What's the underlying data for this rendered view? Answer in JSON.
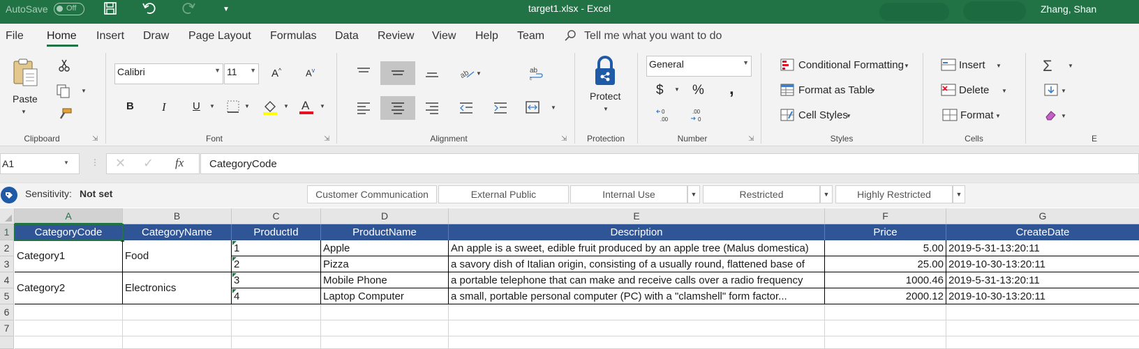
{
  "titlebar": {
    "autosave_label": "AutoSave",
    "autosave_state": "Off",
    "doc_title": "target1.xlsx  -  Excel",
    "user_name": "Zhang, Shan",
    "icons": [
      "save-icon",
      "undo-icon",
      "redo-icon",
      "customize-qat-icon"
    ],
    "accent": "#217346"
  },
  "tabs": [
    "File",
    "Home",
    "Insert",
    "Draw",
    "Page Layout",
    "Formulas",
    "Data",
    "Review",
    "View",
    "Help",
    "Team"
  ],
  "active_tab": "Home",
  "tell_me": "Tell me what you want to do",
  "ribbon": {
    "clipboard": {
      "paste": "Paste",
      "label": "Clipboard"
    },
    "font": {
      "name": "Calibri",
      "size": "11",
      "bold": "B",
      "italic": "I",
      "underline": "U",
      "label": "Font"
    },
    "alignment": {
      "label": "Alignment"
    },
    "protection": {
      "protect": "Protect",
      "label": "Protection"
    },
    "number": {
      "format": "General",
      "currency": "$",
      "percent": "%",
      "comma": ",",
      "increase_decimal": ".00",
      "label": "Number"
    },
    "styles": {
      "conditional": "Conditional Formatting",
      "format_table": "Format as Table",
      "cell_styles": "Cell Styles",
      "label": "Styles"
    },
    "cells": {
      "insert": "Insert",
      "delete": "Delete",
      "format": "Format",
      "label": "Cells"
    },
    "editing": {
      "label": "E"
    }
  },
  "formula_bar": {
    "name_box": "A1",
    "formula": "CategoryCode"
  },
  "sensitivity": {
    "label": "Sensitivity:",
    "value": "Not set",
    "options": [
      "Customer Communication",
      "External Public",
      "Internal Use",
      "Restricted",
      "Highly Restricted"
    ]
  },
  "grid": {
    "columns": [
      "A",
      "B",
      "C",
      "D",
      "E",
      "F",
      "G"
    ],
    "rows": [
      "1",
      "2",
      "3",
      "4",
      "5",
      "6",
      "7"
    ],
    "header_color": "#2f5597",
    "headers": [
      "CategoryCode",
      "CategoryName",
      "ProductId",
      "ProductName",
      "Description",
      "Price",
      "CreateDate"
    ],
    "categories": [
      {
        "code": "Category1",
        "name": "Food"
      },
      {
        "code": "Category2",
        "name": "Electronics"
      }
    ],
    "products": [
      {
        "id": "1",
        "name": "Apple",
        "description": "An apple is a sweet, edible fruit produced by an apple tree (Malus domestica)",
        "price": "5.00",
        "date": "2019-5-31-13:20:11"
      },
      {
        "id": "2",
        "name": "Pizza",
        "description": "a savory dish of Italian origin, consisting of a usually round, flattened base of",
        "price": "25.00",
        "date": "2019-10-30-13:20:11"
      },
      {
        "id": "3",
        "name": "Mobile Phone",
        "description": "a portable telephone that can make and receive calls over a radio frequency",
        "price": "1000.46",
        "date": "2019-5-31-13:20:11"
      },
      {
        "id": "4",
        "name": "Laptop Computer",
        "description": "a small, portable personal computer (PC) with a \"clamshell\" form factor...",
        "price": "2000.12",
        "date": "2019-10-30-13:20:11"
      }
    ]
  }
}
